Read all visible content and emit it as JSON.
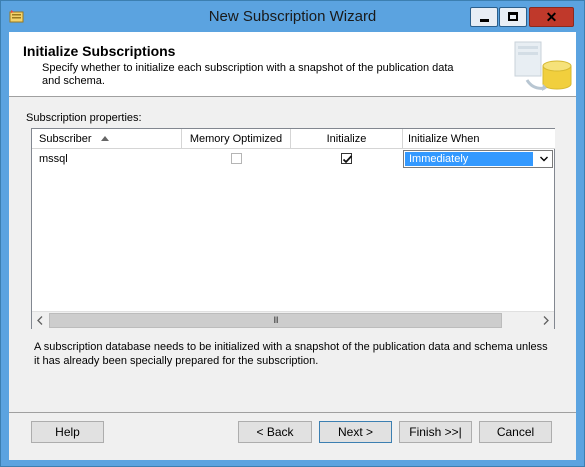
{
  "window": {
    "title": "New Subscription Wizard",
    "close_glyph": "✕"
  },
  "header": {
    "title": "Initialize Subscriptions",
    "description": "Specify whether to initialize each subscription with a snapshot of the publication data and schema."
  },
  "grid": {
    "label": "Subscription properties:",
    "columns": [
      "Subscriber",
      "Memory Optimized",
      "Initialize",
      "Initialize When"
    ],
    "sort_column": "Subscriber",
    "sort_direction": "ascending",
    "rows": [
      {
        "subscriber": "mssql",
        "memory_optimized": false,
        "initialize": true,
        "initialize_when": "Immediately"
      }
    ],
    "scroll_grip": "III"
  },
  "note": "A subscription database needs to be initialized with a snapshot of the publication data and schema unless it has already been specially prepared for the subscription.",
  "buttons": {
    "help": "Help",
    "back": "< Back",
    "next": "Next >",
    "finish": "Finish >>|",
    "cancel": "Cancel"
  },
  "colors": {
    "title_bar": "#5ba3e0",
    "selection": "#3399ff",
    "close_button": "#c0392b"
  }
}
